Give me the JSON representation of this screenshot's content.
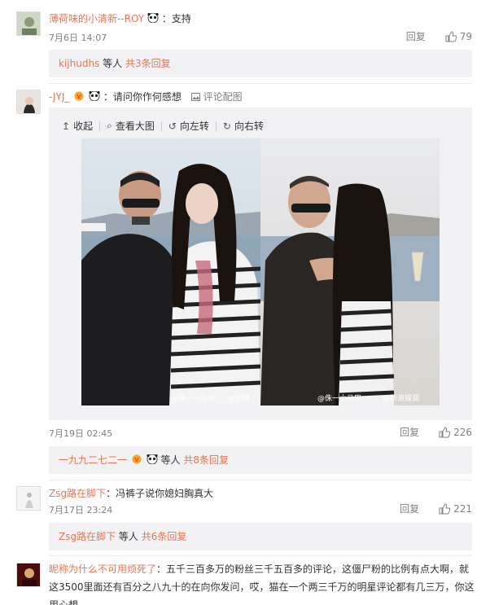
{
  "comments": [
    {
      "user": "薄荷味的小清新--ROY",
      "text": "：支持",
      "time": "7月6日 14:07",
      "reply_label": "回复",
      "likes": "79",
      "sub_text": "kijhudhs 等人 共3条回复",
      "sub_user": "kijhudhs",
      "sub_rest": " 等人 ",
      "sub_more": "共3条回复"
    },
    {
      "user": "-JYJ_",
      "text": "：请问你作何感想",
      "pic_link": "评论配图",
      "toolbar": [
        "收起",
        "查看大图",
        "向左转",
        "向右转"
      ],
      "watermarks": [
        "@侏一小马甲",
        "@招财",
        "@侏一小马甲",
        "@新浪娱调"
      ],
      "time": "7月19日 02:45",
      "reply_label": "回复",
      "likes": "226",
      "sub_user": "一九九二七二一",
      "sub_rest": " 等人 ",
      "sub_more": "共8条回复"
    },
    {
      "user": "Zsg路在脚下",
      "text": "：冯裤子说你媳妇胸真大",
      "time": "7月17日 23:24",
      "reply_label": "回复",
      "likes": "221",
      "sub_user": "Zsg路在脚下",
      "sub_rest": " 等人 ",
      "sub_more": "共6条回复"
    },
    {
      "user": "昵称为什么不可用烦死了",
      "text": "：五千三百多万的粉丝三千五百多的评论，这僵尸粉的比例有点大啊，就",
      "text_line2": "这3500里面还有百分之八九十的在向你发问，哎，猫在一个两三千万的明星评论都有几三万，你这",
      "text_line3": "用心想。"
    }
  ],
  "colors": {
    "link": "#eb7350",
    "meta": "#808080",
    "panel": "#f2f2f5"
  }
}
